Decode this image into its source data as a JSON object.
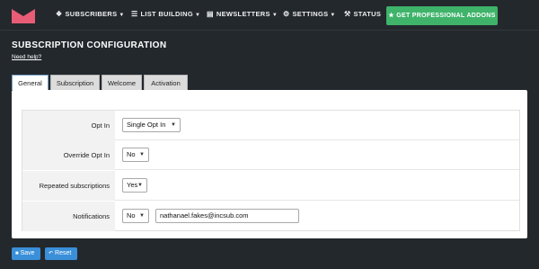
{
  "nav": {
    "items": [
      {
        "label": "SUBSCRIBERS",
        "icon": "users-icon",
        "glyph": "❖",
        "caret": true
      },
      {
        "label": "LIST BUILDING",
        "icon": "list-icon",
        "glyph": "☰",
        "caret": true
      },
      {
        "label": "NEWSLETTERS",
        "icon": "newsletter-icon",
        "glyph": "▤",
        "caret": true
      },
      {
        "label": "SETTINGS",
        "icon": "gear-icon",
        "glyph": "⚙",
        "caret": true
      },
      {
        "label": "STATUS",
        "icon": "wrench-icon",
        "glyph": "⚒",
        "caret": false
      }
    ],
    "pro_label": "GET PROFESSIONAL ADDONS",
    "pro_icon": "trophy-icon",
    "brand_color": "#e85d75",
    "pro_color": "#3fb36a"
  },
  "page": {
    "title": "SUBSCRIPTION CONFIGURATION",
    "help": "Need help?"
  },
  "tabs": [
    {
      "label": "General",
      "active": true
    },
    {
      "label": "Subscription",
      "active": false
    },
    {
      "label": "Welcome",
      "active": false
    },
    {
      "label": "Activation",
      "active": false
    }
  ],
  "form": {
    "opt_in": {
      "label": "Opt In",
      "value": "Single Opt In"
    },
    "override_opt_in": {
      "label": "Override Opt In",
      "value": "No"
    },
    "repeated": {
      "label": "Repeated subscriptions",
      "value": "Yes"
    },
    "notifications": {
      "label": "Notifications",
      "value": "No",
      "email": "nathanael.fakes@incsub.com"
    }
  },
  "actions": {
    "save_label": "Save",
    "reset_label": "Reset",
    "button_color": "#3a8fd9"
  }
}
